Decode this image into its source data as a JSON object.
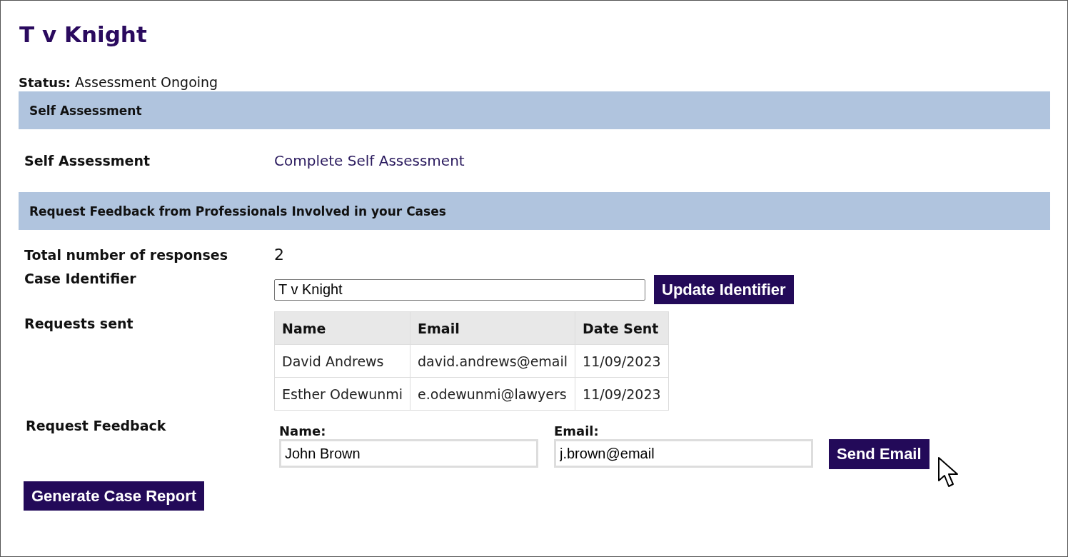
{
  "title": "T v Knight",
  "status": {
    "label": "Status:",
    "value": "Assessment Ongoing"
  },
  "self_assessment": {
    "header": "Self Assessment",
    "label": "Self Assessment",
    "link": "Complete Self Assessment"
  },
  "feedback": {
    "header": "Request Feedback from Professionals Involved in your Cases",
    "responses": {
      "label": "Total number of responses",
      "value": "2"
    },
    "identifier": {
      "label": "Case Identifier",
      "value": "T v Knight",
      "button": "Update Identifier"
    },
    "requests": {
      "label": "Requests sent",
      "columns": [
        "Name",
        "Email",
        "Date Sent"
      ],
      "rows": [
        [
          "David Andrews",
          "david.andrews@email",
          "11/09/2023"
        ],
        [
          "Esther Odewunmi",
          "e.odewunmi@lawyers",
          "11/09/2023"
        ]
      ]
    },
    "request": {
      "label": "Request Feedback",
      "name_label": "Name:",
      "name_value": "John Brown",
      "email_label": "Email:",
      "email_value": "j.brown@email",
      "button": "Send Email"
    }
  },
  "report_button": "Generate Case Report"
}
